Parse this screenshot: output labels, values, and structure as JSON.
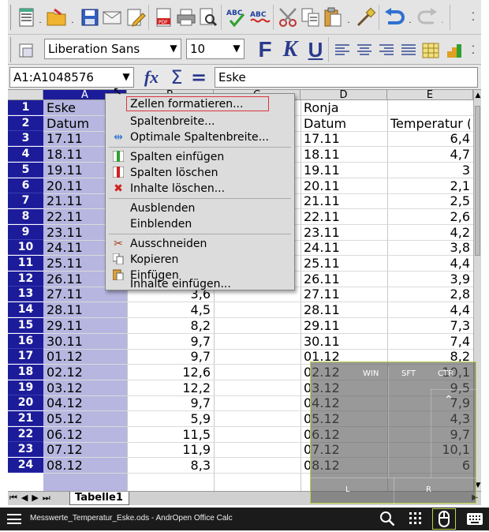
{
  "toolbar": {
    "font_name": "Liberation Sans",
    "font_size": "10",
    "bold_label": "F",
    "italic_label": "K",
    "underline_label": "U"
  },
  "formula_bar": {
    "name_box": "A1:A1048576",
    "fx_label": "fx",
    "sum_label": "Σ",
    "equals_label": "=",
    "content": "Eske"
  },
  "columns": [
    "A",
    "B",
    "C",
    "D",
    "E"
  ],
  "rows": [
    {
      "num": "1",
      "a": "Eske",
      "b": "",
      "d": "Ronja",
      "e": ""
    },
    {
      "num": "2",
      "a": "Datum",
      "b": "",
      "d": "Datum",
      "e": "Temperatur (°"
    },
    {
      "num": "3",
      "a": "17.11",
      "b": "",
      "d": "17.11",
      "e": "6,4"
    },
    {
      "num": "4",
      "a": "18.11",
      "b": "",
      "d": "18.11",
      "e": "4,7"
    },
    {
      "num": "5",
      "a": "19.11",
      "b": "",
      "d": "19.11",
      "e": "3"
    },
    {
      "num": "6",
      "a": "20.11",
      "b": "",
      "d": "20.11",
      "e": "2,1"
    },
    {
      "num": "7",
      "a": "21.11",
      "b": "",
      "d": "21.11",
      "e": "2,5"
    },
    {
      "num": "8",
      "a": "22.11",
      "b": "",
      "d": "22.11",
      "e": "2,6"
    },
    {
      "num": "9",
      "a": "23.11",
      "b": "",
      "d": "23.11",
      "e": "4,2"
    },
    {
      "num": "10",
      "a": "24.11",
      "b": "",
      "d": "24.11",
      "e": "3,8"
    },
    {
      "num": "11",
      "a": "25.11",
      "b": "",
      "d": "25.11",
      "e": "4,4"
    },
    {
      "num": "12",
      "a": "26.11",
      "b": "4,..",
      "d": "26.11",
      "e": "3,9"
    },
    {
      "num": "13",
      "a": "27.11",
      "b": "3,6",
      "d": "27.11",
      "e": "2,8"
    },
    {
      "num": "14",
      "a": "28.11",
      "b": "4,5",
      "d": "28.11",
      "e": "4,4"
    },
    {
      "num": "15",
      "a": "29.11",
      "b": "8,2",
      "d": "29.11",
      "e": "7,3"
    },
    {
      "num": "16",
      "a": "30.11",
      "b": "9,7",
      "d": "30.11",
      "e": "7,4"
    },
    {
      "num": "17",
      "a": "01.12",
      "b": "9,7",
      "d": "01.12",
      "e": "8,2"
    },
    {
      "num": "18",
      "a": "02.12",
      "b": "12,6",
      "d": "02.12",
      "e": "10,1"
    },
    {
      "num": "19",
      "a": "03.12",
      "b": "12,2",
      "d": "03.12",
      "e": "9,5"
    },
    {
      "num": "20",
      "a": "04.12",
      "b": "9,7",
      "d": "04.12",
      "e": "7,9"
    },
    {
      "num": "21",
      "a": "05.12",
      "b": "5,9",
      "d": "05.12",
      "e": "4,3"
    },
    {
      "num": "22",
      "a": "06.12",
      "b": "11,5",
      "d": "06.12",
      "e": "9,7"
    },
    {
      "num": "23",
      "a": "07.12",
      "b": "11,9",
      "d": "07.12",
      "e": "10,1"
    },
    {
      "num": "24",
      "a": "08.12",
      "b": "8,3",
      "d": "08.12",
      "e": "6"
    }
  ],
  "context_menu": {
    "items": [
      {
        "label": "Zellen formatieren...",
        "icon": ""
      },
      {
        "label": "Spaltenbreite...",
        "icon": ""
      },
      {
        "label": "Optimale Spaltenbreite...",
        "icon": "column-width-icon"
      },
      {
        "label": "Spalten einfügen",
        "icon": "insert-columns-icon"
      },
      {
        "label": "Spalten löschen",
        "icon": "delete-columns-icon"
      },
      {
        "label": "Inhalte löschen...",
        "icon": "delete-contents-icon"
      },
      {
        "label": "Ausblenden",
        "icon": ""
      },
      {
        "label": "Einblenden",
        "icon": ""
      },
      {
        "label": "Ausschneiden",
        "icon": "scissors-icon"
      },
      {
        "label": "Kopieren",
        "icon": "copy-icon"
      },
      {
        "label": "Einfügen",
        "icon": "paste-icon"
      },
      {
        "label": "Inhalte einfügen...",
        "icon": ""
      }
    ]
  },
  "sheet_tabs": {
    "active": "Tabelle1"
  },
  "overlay": {
    "win": "WIN",
    "sft": "SFT",
    "ctr": "CTR",
    "left": "L",
    "right": "R"
  },
  "taskbar": {
    "title": "Messwerte_Temperatur_Eske.ods - AndrOpen Office Calc"
  },
  "colors": {
    "row_header": "#1c1c9a",
    "selection": "#b6b6e0",
    "overlay_border": "#b9d24a",
    "menu_highlight_border": "#d9363e"
  }
}
